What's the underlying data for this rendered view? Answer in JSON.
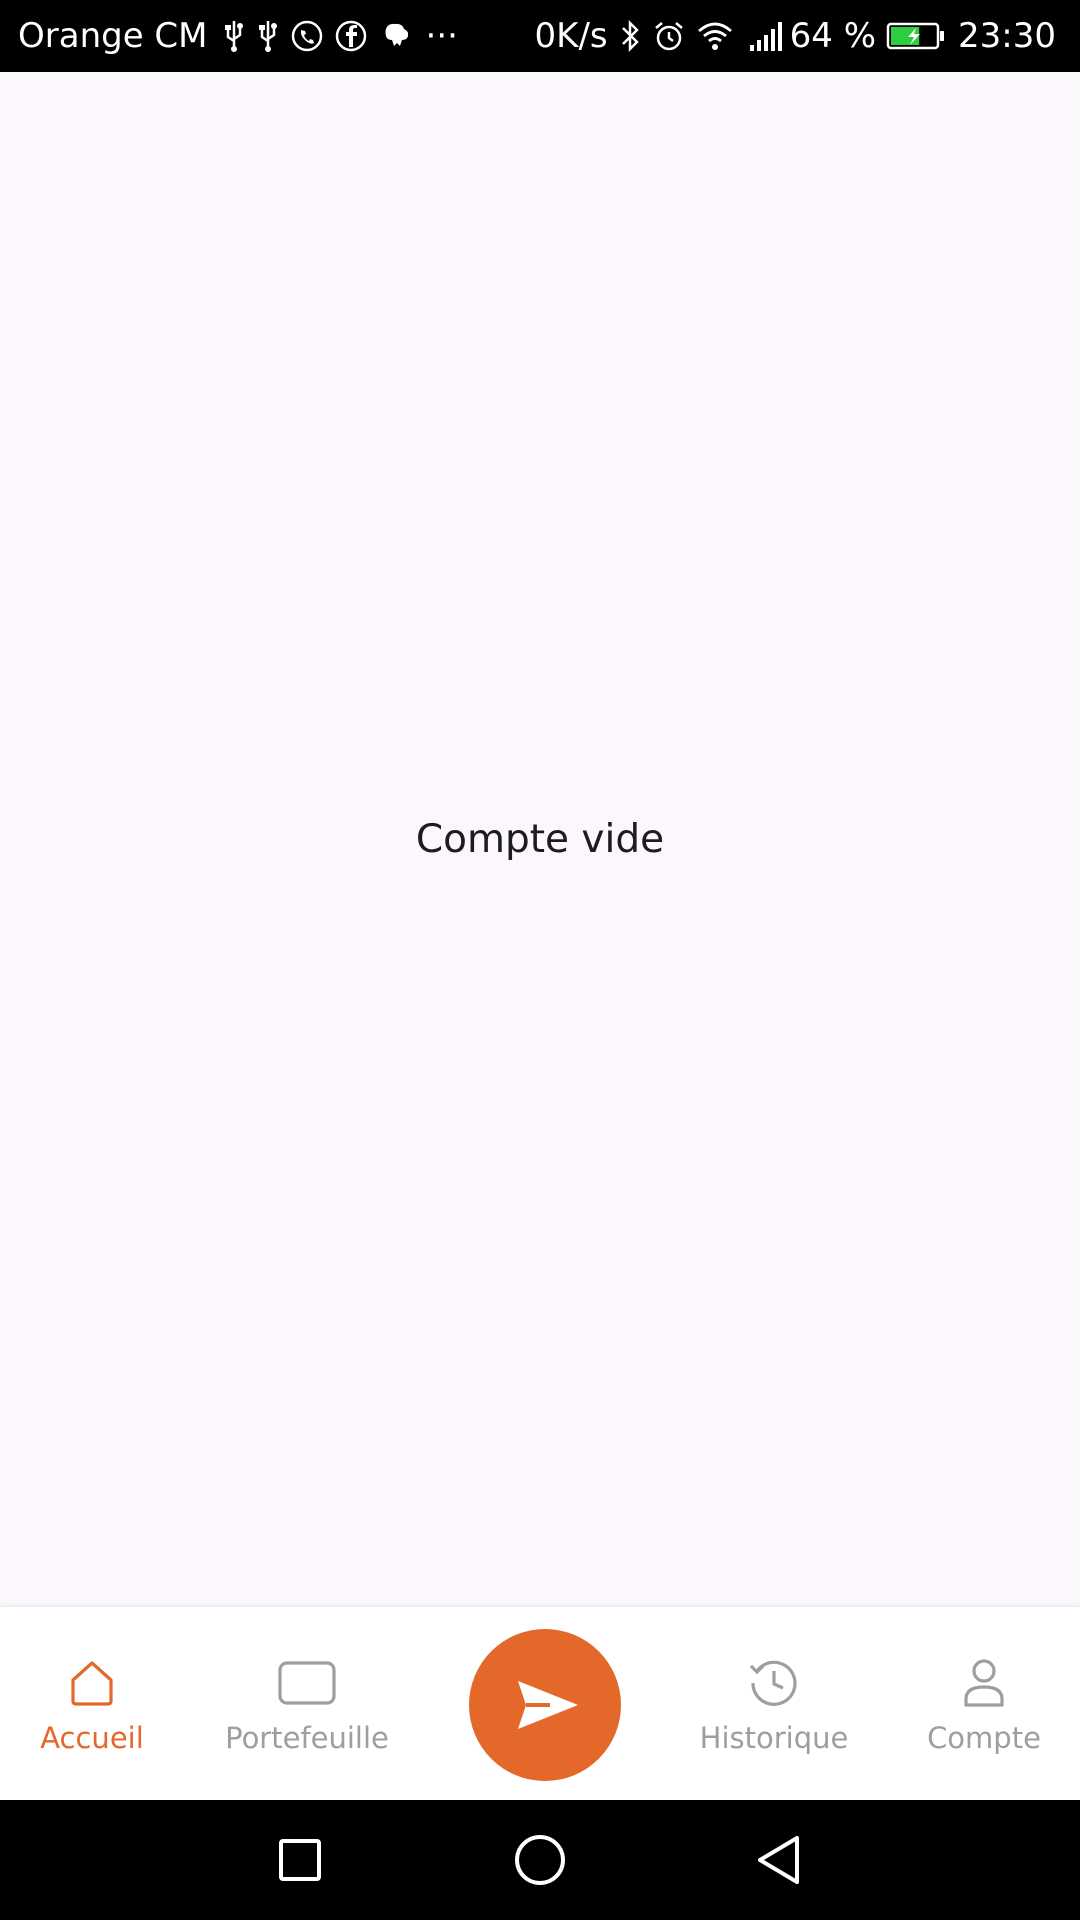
{
  "status_bar": {
    "carrier": "Orange CM",
    "more_indicator": "···",
    "network_speed": "0K/s",
    "battery_percent": "64 %",
    "battery_level": 0.64,
    "time": "23:30",
    "left_icons": [
      "usb-icon",
      "usb-icon",
      "whatsapp-icon",
      "facebook-icon",
      "app-notification-icon"
    ],
    "right_icons": [
      "bluetooth-icon",
      "alarm-icon",
      "wifi-icon",
      "signal-icon",
      "battery-charging-icon"
    ]
  },
  "main": {
    "empty_message": "Compte vide"
  },
  "bottom_nav": {
    "items": [
      {
        "label": "Accueil",
        "icon": "home-icon",
        "active": true
      },
      {
        "label": "Portefeuille",
        "icon": "wallet-icon",
        "active": false
      },
      {
        "label": "Historique",
        "icon": "history-icon",
        "active": false
      },
      {
        "label": "Compte",
        "icon": "profile-icon",
        "active": false
      }
    ],
    "fab_icon": "send-icon"
  },
  "android_nav": {
    "buttons": [
      "recents-icon",
      "home-circle-icon",
      "back-icon"
    ]
  },
  "colors": {
    "accent": "#e4682a",
    "background": "#fcf6fd",
    "inactive": "#9e9e9e",
    "text": "#1c1b1f"
  }
}
